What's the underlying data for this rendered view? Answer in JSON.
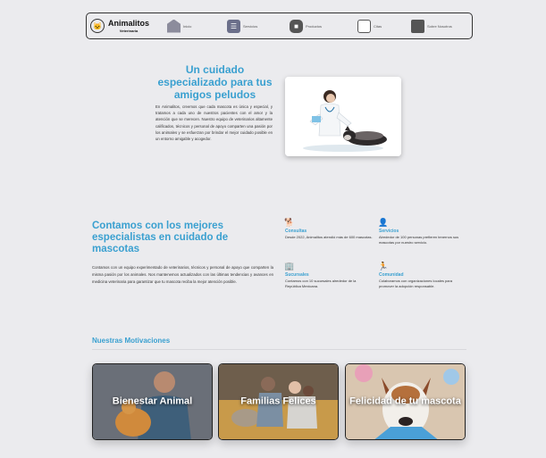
{
  "brand": {
    "name": "Animalitos",
    "subtitle": "Veterinaria",
    "logo_icon": "cat-icon"
  },
  "nav": {
    "items": [
      {
        "label": "Inicio",
        "icon": "home-icon"
      },
      {
        "label": "Servicios",
        "icon": "checklist-icon"
      },
      {
        "label": "Productos",
        "icon": "box-icon"
      },
      {
        "label": "Citas",
        "icon": "calendar-icon"
      },
      {
        "label": "Sobre Nosotros",
        "icon": "building-icon"
      }
    ]
  },
  "hero": {
    "title": "Un cuidado especializado para tus amigos peludos",
    "text": "En Animalitos, creemos que cada mascota es única y especial, y tratamos a cada uno de nuestros pacientes con el amor y la atención que se merecen. Nuestro equipo de veterinarios altamente calificados, técnicos y personal de apoyo comparten una pasión por los animales y se esfuerzan por brindar el mejor cuidado posible en un entorno amigable y acogedor.",
    "image": "veterinarian-with-dog"
  },
  "specialists": {
    "title": "Contamos con los mejores especialistas en cuidado de mascotas",
    "text": "Contamos con un equipo experimentado de veterinarios, técnicos y personal de apoyo que comparten la misma pasión por los animales. Nos mantenemos actualizados con las últimas tendencias y avances en medicina veterinaria para garantizar que tu mascota reciba la mejor atención posible.",
    "stats": [
      {
        "title": "Consultas",
        "text": "Desde 2022, Animalitos atendió más de 600 mascotas.",
        "icon": "dog-icon"
      },
      {
        "title": "Servicios",
        "text": "Alrededor de 100 personas prefieren tenernos sus mascotas por nuestro servicio.",
        "icon": "person-icon"
      },
      {
        "title": "Sucursales",
        "text": "Contamos con 10 sucursales alrededor de la República Mexicana.",
        "icon": "building-icon"
      },
      {
        "title": "Comunidad",
        "text": "Colaboramos con organizaciones locales para promover la adopción responsable.",
        "icon": "standing-person-icon"
      }
    ]
  },
  "motivations": {
    "title": "Nuestras Motivaciones",
    "cards": [
      {
        "label": "Bienestar Animal",
        "image": "vet-holding-cat"
      },
      {
        "label": "Familias Felices",
        "image": "family-on-sofa"
      },
      {
        "label": "Felicidad de tu mascota",
        "image": "happy-dog"
      }
    ]
  },
  "colors": {
    "accent": "#3aa0d0",
    "background": "#ebebee",
    "text": "#222222"
  }
}
